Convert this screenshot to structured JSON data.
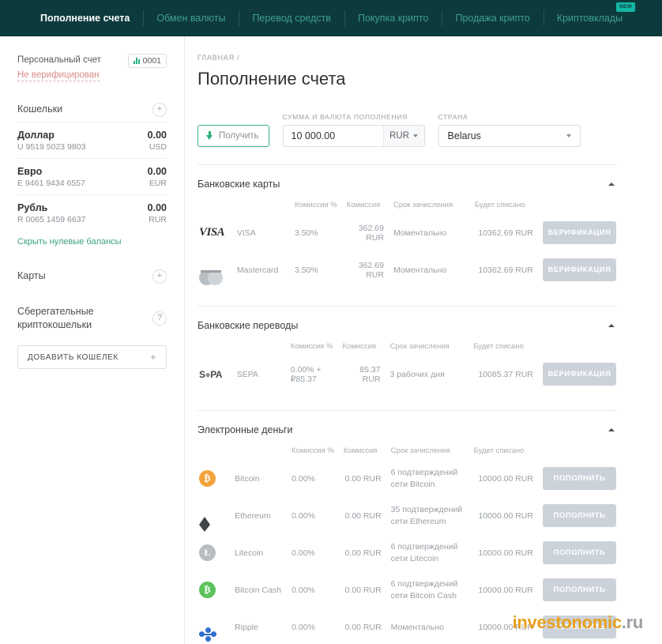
{
  "nav": {
    "items": [
      {
        "label": "Пополнение счета",
        "active": true,
        "badge": null
      },
      {
        "label": "Обмен валюты",
        "active": false,
        "badge": null
      },
      {
        "label": "Перевод средств",
        "active": false,
        "badge": null
      },
      {
        "label": "Покупка крипто",
        "active": false,
        "badge": null
      },
      {
        "label": "Продажа крипто",
        "active": false,
        "badge": null
      },
      {
        "label": "Криптовклады",
        "active": false,
        "badge": "NEW"
      }
    ]
  },
  "sidebar": {
    "account_title": "Персональный счет",
    "account_status": "Не верифицирован",
    "account_badge": "0001",
    "wallets_label": "Кошельки",
    "wallets_add": "+",
    "wallets": [
      {
        "name": "Доллар",
        "amount": "0.00",
        "account": "U 9519 5023 9803",
        "currency": "USD"
      },
      {
        "name": "Евро",
        "amount": "0.00",
        "account": "E 9461 9434 6557",
        "currency": "EUR"
      },
      {
        "name": "Рубль",
        "amount": "0.00",
        "account": "R 0065 1459 6637",
        "currency": "RUR"
      }
    ],
    "hide_zero_balances": "Скрыть нулевые балансы",
    "cards_label": "Карты",
    "cards_add": "+",
    "savings_label": "Сберегательные криптокошельки",
    "savings_help": "?",
    "add_wallet_label": "ДОБАВИТЬ КОШЕЛЕК",
    "add_wallet_plus": "+"
  },
  "main": {
    "breadcrumb": "ГЛАВНАЯ /",
    "title": "Пополнение счета",
    "form": {
      "receive_button": "Получить",
      "amount_label": "СУММА И ВАЛЮТА ПОПОЛНЕНИЯ",
      "amount_value": "10 000.00",
      "currency_value": "RUR",
      "country_label": "СТРАНА",
      "country_value": "Belarus"
    },
    "columns": {
      "fee_pct": "Комиссия %",
      "fee": "Комиссия",
      "term": "Срок зачисления",
      "total": "Будет списано"
    },
    "sections": [
      {
        "title": "Банковские карты",
        "rows": [
          {
            "logo": "visa-logo",
            "name": "VISA",
            "fee_pct": "3.50%",
            "fee": "362.69 RUR",
            "term": "Моментально",
            "total": "10362.69 RUR",
            "action": "ВЕРИФИКАЦИЯ"
          },
          {
            "logo": "mastercard-logo",
            "name": "Mastercard",
            "fee_pct": "3.50%",
            "fee": "362.69 RUR",
            "term": "Моментально",
            "total": "10362.69 RUR",
            "action": "ВЕРИФИКАЦИЯ"
          }
        ]
      },
      {
        "title": "Банковские переводы",
        "rows": [
          {
            "logo": "sepa-logo",
            "name": "SEPA",
            "fee_pct": "0.00% + ₽85.37",
            "fee": "85.37 RUR",
            "term": "3 рабочих дня",
            "total": "10085.37 RUR",
            "action": "ВЕРИФИКАЦИЯ"
          }
        ]
      },
      {
        "title": "Электронные деньги",
        "rows": [
          {
            "logo": "bitcoin-icon",
            "name": "Bitcoin",
            "fee_pct": "0.00%",
            "fee": "0.00 RUR",
            "term": "6 подтверждений сети Bitcoin",
            "total": "10000.00 RUR",
            "action": "ПОПОЛНИТЬ"
          },
          {
            "logo": "ethereum-icon",
            "name": "Ethereum",
            "fee_pct": "0.00%",
            "fee": "0.00 RUR",
            "term": "35 подтверждений сети Ethereum",
            "total": "10000.00 RUR",
            "action": "ПОПОЛНИТЬ"
          },
          {
            "logo": "litecoin-icon",
            "name": "Litecoin",
            "fee_pct": "0.00%",
            "fee": "0.00 RUR",
            "term": "6 подтверждений сети Litecoin",
            "total": "10000.00 RUR",
            "action": "ПОПОЛНИТЬ"
          },
          {
            "logo": "bitcoin-cash-icon",
            "name": "Bitcoin Cash",
            "fee_pct": "0.00%",
            "fee": "0.00 RUR",
            "term": "6 подтверждений сети Bitcoin Cash",
            "total": "10000.00 RUR",
            "action": "ПОПОЛНИТЬ"
          },
          {
            "logo": "ripple-icon",
            "name": "Ripple",
            "fee_pct": "0.00%",
            "fee": "0.00 RUR",
            "term": "Моментально",
            "total": "10000.00 RUR",
            "action": "ПОПОЛНИТЬ"
          }
        ]
      }
    ]
  },
  "watermark": {
    "brand": "investonomic",
    "tld": ".ru"
  },
  "colors": {
    "nav_bg": "#0d3a3c",
    "nav_link": "#3fa08a",
    "accent_green": "#2fae77",
    "badge_new": "#14b8a6",
    "action_btn": "#ccd2d9",
    "warning": "#d98b8b"
  }
}
